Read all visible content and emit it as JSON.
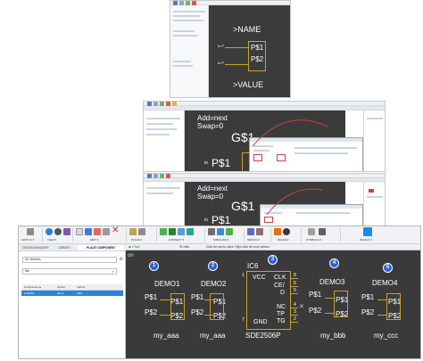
{
  "shot1": {
    "name_label": ">NAME",
    "value_label": ">VALUE",
    "pin1": "P$1",
    "pin2": "P$2",
    "pin_dir1": "io P",
    "pin_dir2": "io P"
  },
  "shot2": {
    "add_label": "Add=next",
    "swap_label": "Swap=0",
    "gate_label": "G$1",
    "pin_label": "P$1",
    "pin_prefix": "io"
  },
  "shot3": {
    "add_label": "Add=next",
    "swap_label": "Swap=0",
    "gate_label": "G$1",
    "pin_label": "P$1",
    "pin_prefix": "io"
  },
  "main": {
    "ribbon": {
      "groups": [
        {
          "label": "SWITCH ▾"
        },
        {
          "label": "VIEW ▾"
        },
        {
          "label": "EDIT ▾"
        },
        {
          "label": "PLACE ▾"
        },
        {
          "label": "CONNECT ▾"
        },
        {
          "label": "SIMULATE ▾"
        },
        {
          "label": "DESIGN ▾"
        },
        {
          "label": "RULES ▾"
        },
        {
          "label": "SYMBOLS ▾"
        },
        {
          "label": "SELECT ▾"
        }
      ]
    },
    "panel": {
      "tabs": [
        "DESIGN MANAGER",
        "LIBRARY",
        "PLACE COMPONENT"
      ],
      "filter_value": "All Libraries",
      "search_value": "lbls",
      "columns": [
        "Component ▲",
        "Library",
        "Variant"
      ],
      "rows": [
        {
          "component": "DEMO",
          "library": "demo",
          "variant": "ABC"
        }
      ]
    },
    "status": {
      "layer": "91 Nets",
      "hint": "Click the part to place. Right click for more options."
    },
    "schematic": {
      "corner_label": "on",
      "parts": [
        {
          "badge": "1",
          "name": "DEMO1",
          "value": "my_aaa",
          "p1": "P$1",
          "p2": "P$2"
        },
        {
          "badge": "2",
          "name": "DEMO2",
          "value": "my_aaa",
          "p1": "P$1",
          "p2": "P$2"
        },
        {
          "badge": "4",
          "name": "DEMO3",
          "value": "my_bbb",
          "p1": "P$1",
          "p2": "P$2"
        },
        {
          "badge": "5",
          "name": "DEMO4",
          "value": "my_ccc",
          "p1": "P$1",
          "p2": "P$2"
        }
      ],
      "ic": {
        "badge": "3",
        "name": "IC6",
        "value": "SDE2506P",
        "left_pins": [
          "VCC",
          "GND"
        ],
        "right_pins": [
          "CLK",
          "CE/",
          "D",
          "NC",
          "TP",
          "TG"
        ],
        "pin_numbers": [
          "8",
          "6",
          "5",
          "4",
          "3",
          "2"
        ],
        "left_numbers": [
          "1",
          "7"
        ]
      }
    }
  },
  "colors": {
    "canvas": "#3a3a3a",
    "symbol": "#c9a227",
    "badge": "#2f5fd6",
    "selection": "#2d84d6"
  }
}
